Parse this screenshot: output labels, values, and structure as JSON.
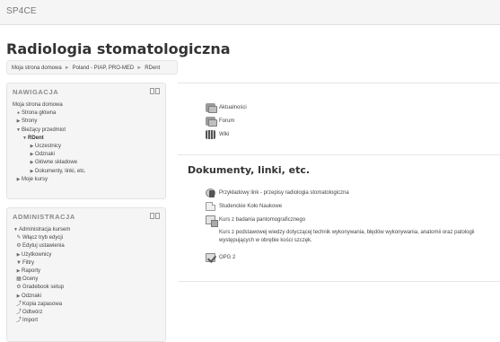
{
  "site": {
    "brand": "SP4CE"
  },
  "course": {
    "title": "Radiologia stomatologiczna"
  },
  "breadcrumb": {
    "items": [
      "Moja strona domowa",
      "Poland - PIAP, PRO-MED",
      "RDent"
    ],
    "separator": "►"
  },
  "navigation": {
    "title": "NAWIGACJA",
    "items": [
      {
        "label": "Moja strona domowa"
      },
      {
        "label": "Strona główna"
      },
      {
        "label": "Strony"
      },
      {
        "label": "Bieżący przedmiot"
      },
      {
        "label": "RDent"
      },
      {
        "label": "Uczestnicy"
      },
      {
        "label": "Odznaki"
      },
      {
        "label": "Główne składowe"
      },
      {
        "label": "Dokumenty, linki, etc."
      },
      {
        "label": "Moje kursy"
      }
    ]
  },
  "administration": {
    "title": "ADMINISTRACJA",
    "items": [
      {
        "label": "Administracja kursem"
      },
      {
        "label": "Włącz tryb edycji"
      },
      {
        "label": "Edytuj ustawienia"
      },
      {
        "label": "Użytkownicy"
      },
      {
        "label": "Filtry"
      },
      {
        "label": "Raporty"
      },
      {
        "label": "Oceny"
      },
      {
        "label": "Gradebook setup"
      },
      {
        "label": "Odznaki"
      },
      {
        "label": "Kopia zapasowa"
      },
      {
        "label": "Odtwórz"
      },
      {
        "label": "Import"
      }
    ]
  },
  "section_general": {
    "activities": [
      {
        "label": "Aktualności",
        "icon": "forum-icon"
      },
      {
        "label": "Forum",
        "icon": "forum-icon"
      },
      {
        "label": "Wiki",
        "icon": "wiki-icon"
      }
    ]
  },
  "section_docs": {
    "heading": "Dokumenty, linki, etc.",
    "activities": [
      {
        "label": "Przykładowy link - przepisy radiologia stomatologiczna",
        "icon": "url-icon"
      },
      {
        "label": "Studenckie Koło Naukowe",
        "icon": "file-icon"
      },
      {
        "label": "Kurs z badania pantomograficznego",
        "icon": "folder-icon"
      },
      {
        "label": "OPG 2",
        "icon": "quiz-icon"
      }
    ],
    "description": "Kurs z podstawowej wiedzy dotyczącej technik wykonywania, błędów wykonywania, anatomii oraz patologii występujących w obrębie kości szczęk."
  }
}
